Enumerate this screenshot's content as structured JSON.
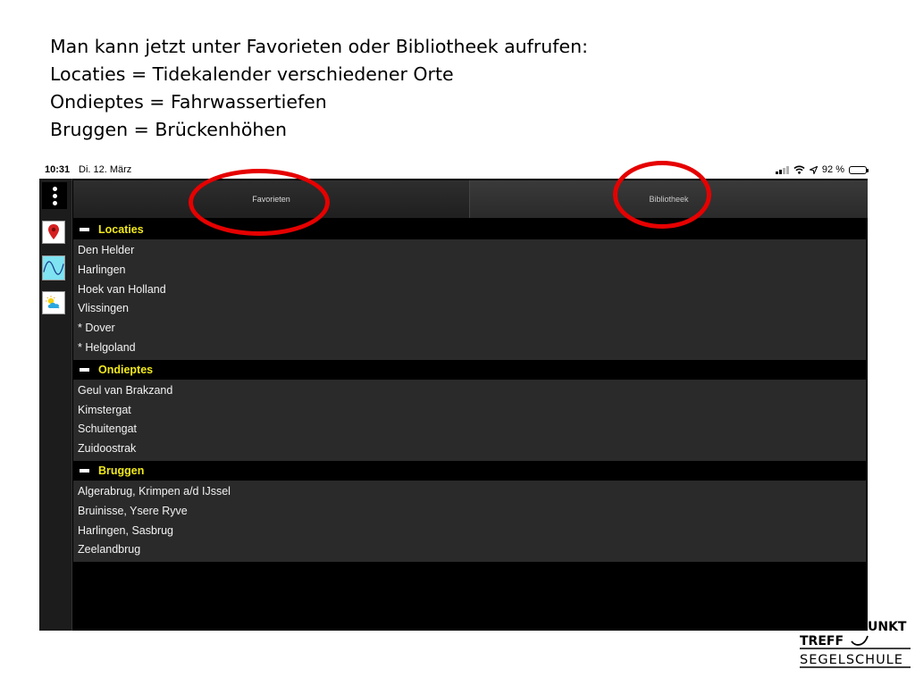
{
  "caption": {
    "lines": [
      "Man kann jetzt unter Favorieten oder Bibliotheek aufrufen:",
      "Locaties = Tidekalender verschiedener Orte",
      "Ondieptes = Fahrwassertiefen",
      "Bruggen =  Brückenhöhen"
    ]
  },
  "status_bar": {
    "time": "10:31",
    "date": "Di. 12. März",
    "battery": "92 %",
    "battery_level": 0.92,
    "icons": [
      "signal-icon",
      "wifi-icon",
      "location-arrow-icon",
      "battery-icon"
    ]
  },
  "sidebar": {
    "menu_icon": "more-vertical-icon",
    "items": [
      {
        "icon": "map-pin-icon"
      },
      {
        "icon": "tide-wave-icon"
      },
      {
        "icon": "weather-icon"
      }
    ]
  },
  "tabs": [
    {
      "label": "Favorieten",
      "selected": true
    },
    {
      "label": "Bibliotheek",
      "selected": false
    }
  ],
  "sections": [
    {
      "title": "Locaties",
      "items": [
        "Den Helder",
        "Harlingen",
        "Hoek van Holland",
        "Vlissingen",
        "* Dover",
        "* Helgoland"
      ]
    },
    {
      "title": "Ondieptes",
      "items": [
        "Geul van Brakzand",
        "Kimstergat",
        "Schuitengat",
        "Zuidoostrak"
      ]
    },
    {
      "title": "Bruggen",
      "items": [
        "Algerabrug, Krimpen a/d IJssel",
        "Bruinisse, Ysere Ryve",
        "Harlingen, Sasbrug",
        "Zeelandbrug"
      ]
    }
  ],
  "logo": {
    "line1_left": "TREFF",
    "line1_right": "UNKT",
    "line2": "SEGELSCHULE"
  },
  "colors": {
    "annotation_ring": "#e60000",
    "section_title": "#f0e81a",
    "screen_bg": "#000000",
    "row_bg": "#2a2a2a"
  }
}
